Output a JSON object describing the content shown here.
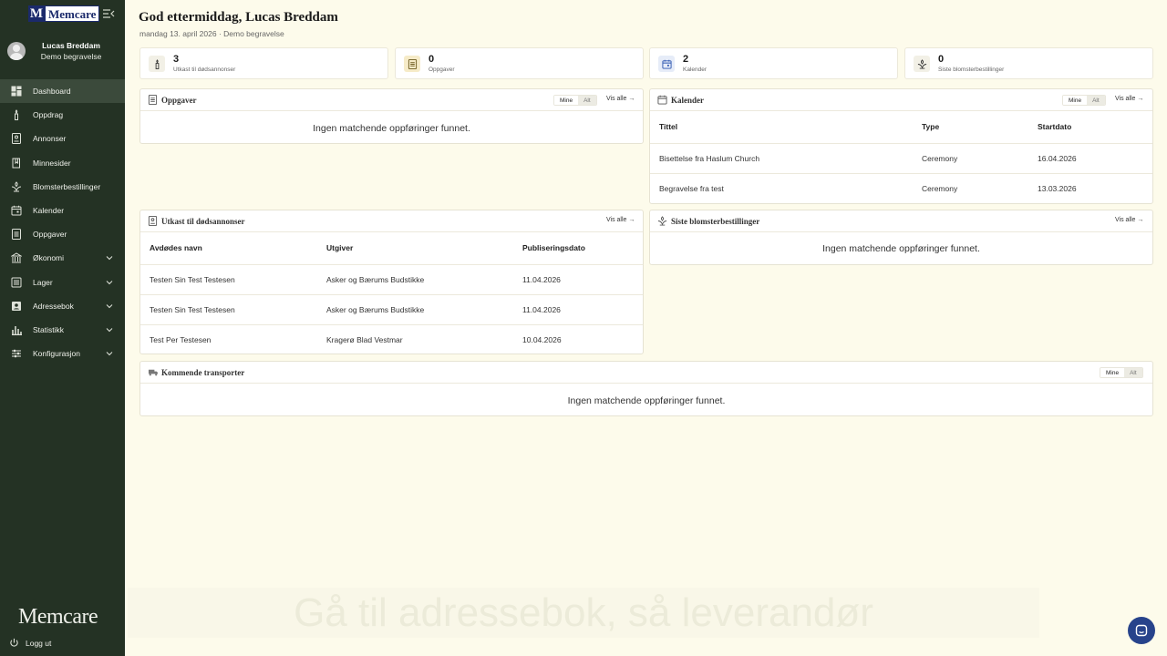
{
  "brand": {
    "logo_letter": "M",
    "logo_word": "Memcare",
    "footer_logo": "Memcare"
  },
  "user": {
    "name": "Lucas Breddam",
    "role": "Demo begravelse"
  },
  "nav": [
    {
      "label": "Dashboard",
      "icon": "dashboard-icon",
      "active": true,
      "expandable": false
    },
    {
      "label": "Oppdrag",
      "icon": "candle-icon",
      "expandable": false
    },
    {
      "label": "Annonser",
      "icon": "announcement-icon",
      "expandable": false
    },
    {
      "label": "Minnesider",
      "icon": "book-icon",
      "expandable": false
    },
    {
      "label": "Blomsterbestillinger",
      "icon": "flower-icon",
      "expandable": false
    },
    {
      "label": "Kalender",
      "icon": "calendar-icon",
      "expandable": false
    },
    {
      "label": "Oppgaver",
      "icon": "tasks-icon",
      "expandable": false
    },
    {
      "label": "Økonomi",
      "icon": "bank-icon",
      "expandable": true
    },
    {
      "label": "Lager",
      "icon": "inventory-icon",
      "expandable": true
    },
    {
      "label": "Adressebok",
      "icon": "contacts-icon",
      "expandable": true
    },
    {
      "label": "Statistikk",
      "icon": "chart-icon",
      "expandable": true
    },
    {
      "label": "Konfigurasjon",
      "icon": "sliders-icon",
      "expandable": true
    }
  ],
  "logout_label": "Logg ut",
  "header": {
    "greeting": "God ettermiddag, Lucas Breddam",
    "subline": "mandag 13. april 2026 · Demo begravelse"
  },
  "stats": [
    {
      "value": "3",
      "label": "Utkast til dødsannonser",
      "icon": "candle-icon"
    },
    {
      "value": "0",
      "label": "Oppgaver",
      "icon": "tasks-icon"
    },
    {
      "value": "2",
      "label": "Kalender",
      "icon": "calendar-icon"
    },
    {
      "value": "0",
      "label": "Siste blomsterbestillinger",
      "icon": "flower-icon"
    }
  ],
  "common": {
    "mine": "Mine",
    "alt": "Alt",
    "vis_alle": "Vis alle →",
    "empty": "Ingen matchende oppføringer funnet."
  },
  "tasks_panel": {
    "title": "Oppgaver"
  },
  "calendar_panel": {
    "title": "Kalender",
    "columns": [
      "Tittel",
      "Type",
      "Startdato"
    ],
    "rows": [
      {
        "title": "Bisettelse fra Haslum Church",
        "type": "Ceremony",
        "date": "16.04.2026"
      },
      {
        "title": "Begravelse fra test",
        "type": "Ceremony",
        "date": "13.03.2026"
      }
    ]
  },
  "drafts_panel": {
    "title": "Utkast til dødsannonser",
    "columns": [
      "Avdødes navn",
      "Utgiver",
      "Publiseringsdato"
    ],
    "rows": [
      {
        "name": "Testen Sin Test Testesen",
        "publisher": "Asker og Bærums Budstikke",
        "date": "11.04.2026"
      },
      {
        "name": "Testen Sin Test Testesen",
        "publisher": "Asker og Bærums Budstikke",
        "date": "11.04.2026"
      },
      {
        "name": "Test Per Testesen",
        "publisher": "Kragerø Blad Vestmar",
        "date": "10.04.2026"
      }
    ]
  },
  "flowers_panel": {
    "title": "Siste blomsterbestillinger"
  },
  "transport_panel": {
    "title": "Kommende transporter"
  },
  "caption": "Gå til adressebok, så leverandør",
  "colors": {
    "sidebar": "#243224",
    "background": "#fdfbeb",
    "warning_date": "#c0392b",
    "chat": "#27438b"
  }
}
